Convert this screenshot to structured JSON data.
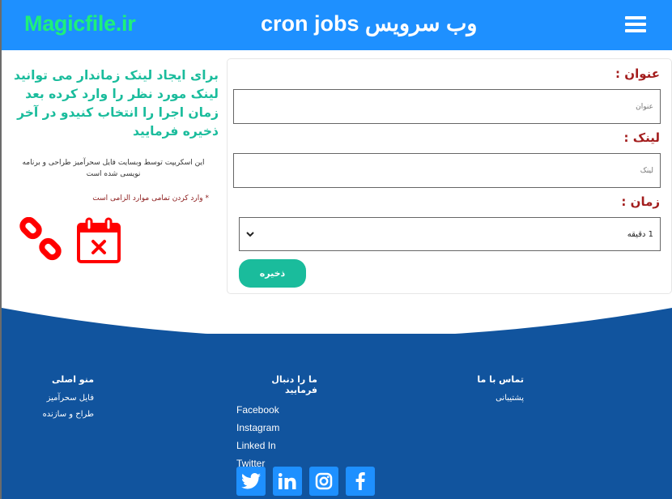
{
  "header": {
    "brand": "Magicfile.ir",
    "title": "وب سرویس cron jobs",
    "menu_icon": "hamburger-menu-icon"
  },
  "info": {
    "heading": "برای ایجاد لینک زماندار می توانید لینک مورد نظر را وارد کرده بعد زمان اجرا را انتخاب کنیدو در آخر ذخیره فرمایید",
    "note": "این اسکریپت توسط وبسایت فایل سحرآمیز طراحی و برنامه نویسی شده است",
    "required_notice": "* وارد کردن تمامی موارد الزامی است",
    "icons": [
      "broken-link-icon",
      "calendar-cancel-icon"
    ]
  },
  "form": {
    "title_label": "عنوان :",
    "title_placeholder": "عنوان",
    "title_value": "",
    "link_label": "لینک :",
    "link_placeholder": "لینک",
    "link_value": "",
    "time_label": "زمان :",
    "time_selected": "1 دقیقه",
    "save_label": "ذخیره"
  },
  "footer": {
    "menu": {
      "heading": "منو اصلی",
      "items": [
        "فایل سحرآمیز",
        "طراح و سازنده"
      ]
    },
    "follow": {
      "heading": "ما را دنبال فرمایید",
      "items": [
        "Facebook",
        "Instagram",
        "Linked In",
        "Twitter"
      ]
    },
    "contact": {
      "heading": "تماس با ما",
      "items": [
        "پشتیبانی"
      ]
    },
    "social_icons": [
      "twitter-icon",
      "linkedin-icon",
      "instagram-icon",
      "facebook-icon"
    ]
  },
  "colors": {
    "header_bg": "#1e90ff",
    "brand": "#1ef07a",
    "accent": "#1abc9c",
    "label": "#a31d1d",
    "footer_bg": "#11549e",
    "icon_red": "#ff0000"
  }
}
